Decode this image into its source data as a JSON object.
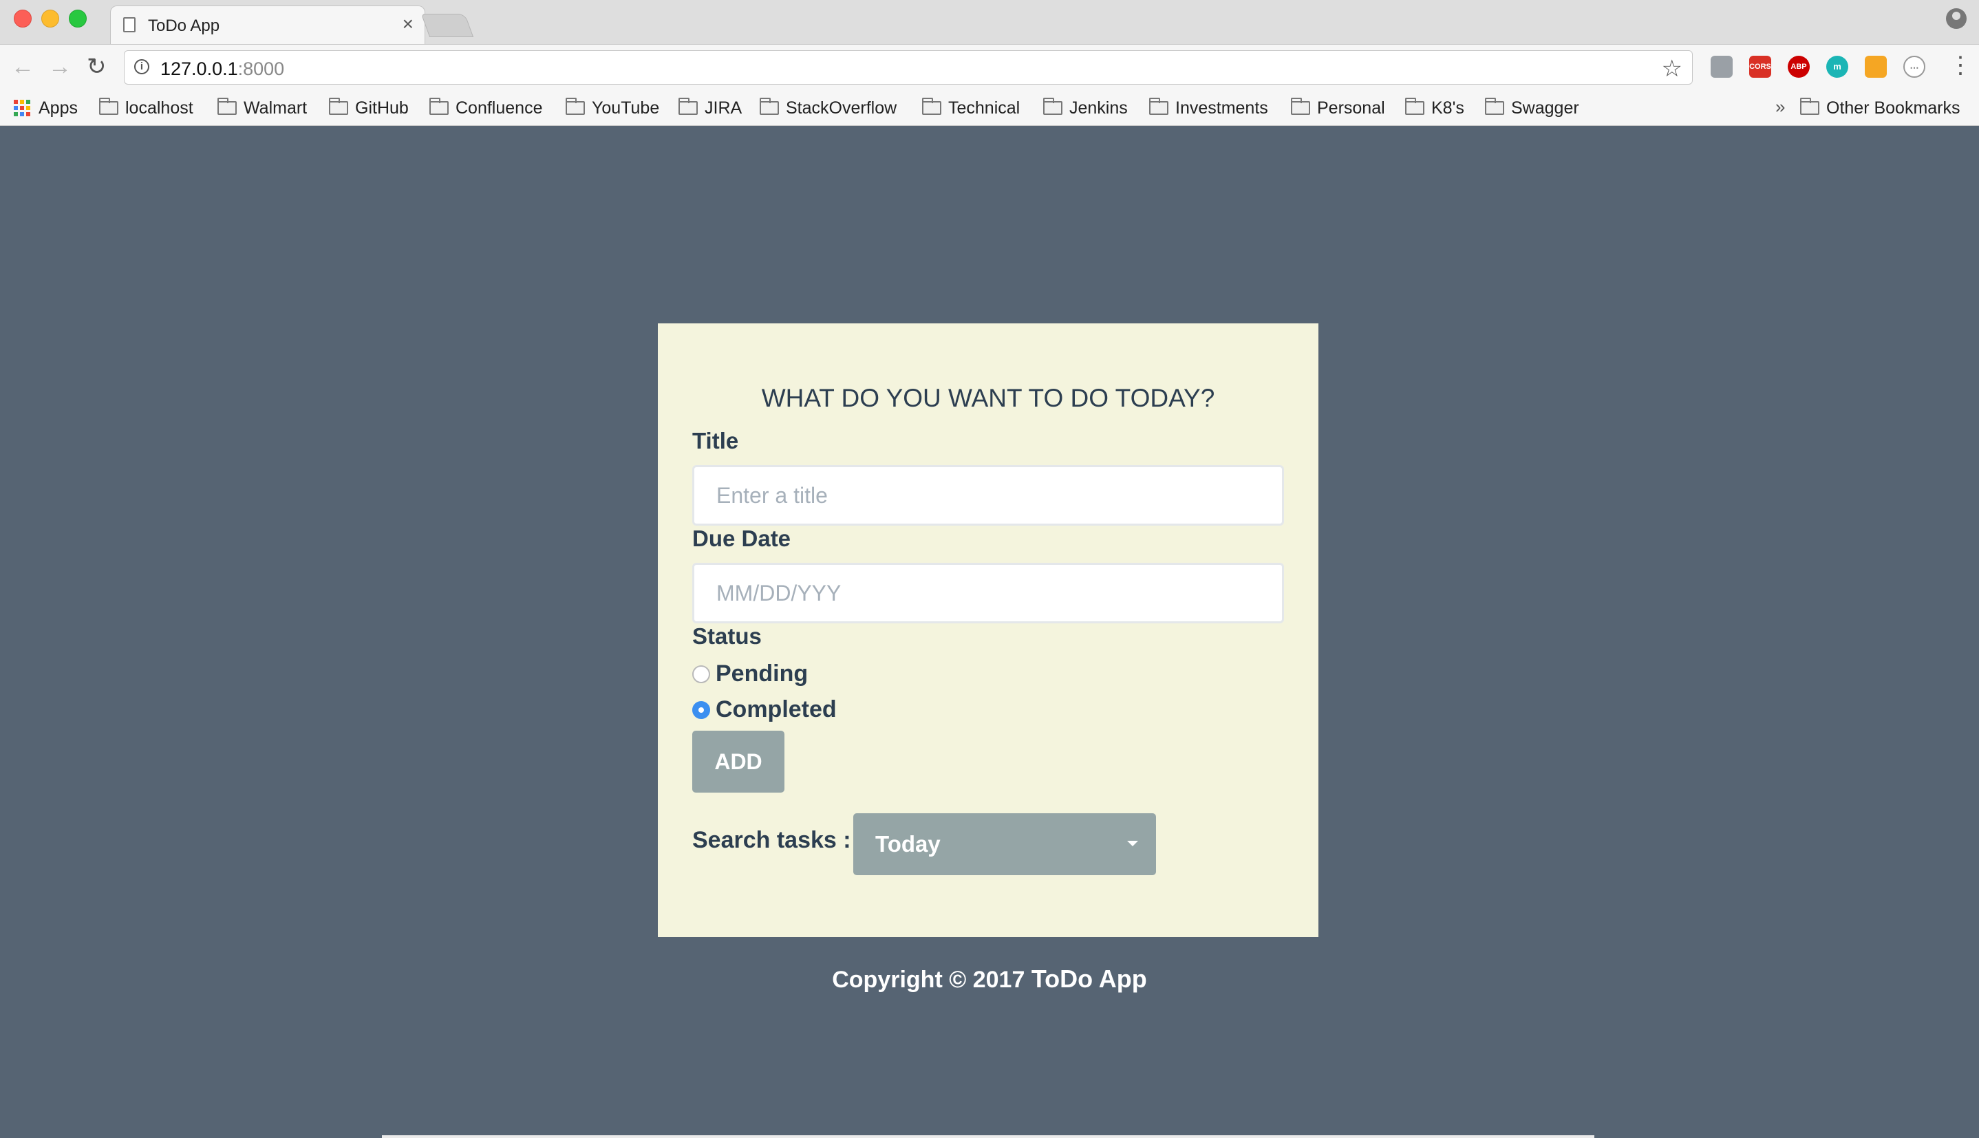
{
  "browser": {
    "tab_title": "ToDo App",
    "tab_close": "×",
    "url_host": "127.0.0.1",
    "url_port": ":8000",
    "extensions": [
      "",
      "CORS",
      "ABP",
      "m",
      "",
      "⋯"
    ],
    "bookmarks": [
      {
        "label": "Apps",
        "icon": "apps-grid-icon"
      },
      {
        "label": "localhost",
        "icon": "folder-icon"
      },
      {
        "label": "Walmart",
        "icon": "folder-icon"
      },
      {
        "label": "GitHub",
        "icon": "folder-icon"
      },
      {
        "label": "Confluence",
        "icon": "folder-icon"
      },
      {
        "label": "YouTube",
        "icon": "folder-icon"
      },
      {
        "label": "JIRA",
        "icon": "folder-icon"
      },
      {
        "label": "StackOverflow",
        "icon": "folder-icon"
      },
      {
        "label": "Technical",
        "icon": "folder-icon"
      },
      {
        "label": "Jenkins",
        "icon": "folder-icon"
      },
      {
        "label": "Investments",
        "icon": "folder-icon"
      },
      {
        "label": "Personal",
        "icon": "folder-icon"
      },
      {
        "label": "K8's",
        "icon": "folder-icon"
      },
      {
        "label": "Swagger",
        "icon": "folder-icon"
      }
    ],
    "overflow_chevron": "»",
    "other_bookmarks": "Other Bookmarks"
  },
  "form": {
    "heading": "WHAT DO YOU WANT TO DO TODAY?",
    "title_label": "Title",
    "title_placeholder": "Enter a title",
    "title_value": "",
    "due_label": "Due Date",
    "due_placeholder": "MM/DD/YYY",
    "due_value": "",
    "status_label": "Status",
    "status_options": [
      {
        "label": "Pending",
        "checked": false
      },
      {
        "label": "Completed",
        "checked": true
      }
    ],
    "add_label": "ADD",
    "search_label": "Search tasks :",
    "search_selected": "Today"
  },
  "footer": {
    "copyright": "Copyright © 2017 ",
    "brand": "ToDo App"
  },
  "colors": {
    "page_bg": "#566473",
    "card_bg": "#f4f4dd",
    "text": "#2c3e50",
    "button_bg": "#95a5a6",
    "radio_checked": "#3b8ff0"
  }
}
